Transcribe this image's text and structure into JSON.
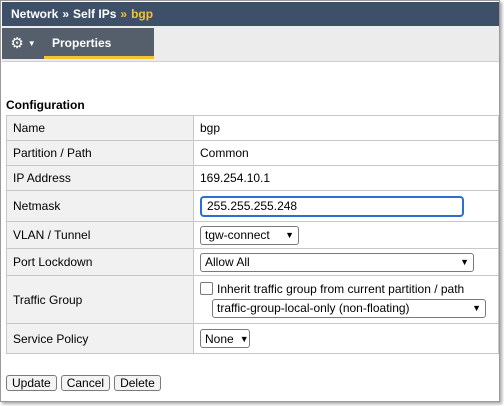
{
  "breadcrumb": {
    "items": [
      "Network",
      "Self IPs"
    ],
    "separator": "»",
    "current": "bgp"
  },
  "tabs": {
    "gear_icon": "gear-icon",
    "active_tab": "Properties"
  },
  "section_title": "Configuration",
  "fields": {
    "name": {
      "label": "Name",
      "value": "bgp"
    },
    "partition": {
      "label": "Partition / Path",
      "value": "Common"
    },
    "ip_address": {
      "label": "IP Address",
      "value": "169.254.10.1"
    },
    "netmask": {
      "label": "Netmask",
      "value": "255.255.255.248"
    },
    "vlan": {
      "label": "VLAN / Tunnel",
      "value": "tgw-connect"
    },
    "port_lockdown": {
      "label": "Port Lockdown",
      "value": "Allow All"
    },
    "traffic_group": {
      "label": "Traffic Group",
      "inherit_label": "Inherit traffic group from current partition / path",
      "inherit_checked": false,
      "value": "traffic-group-local-only (non-floating)"
    },
    "service_policy": {
      "label": "Service Policy",
      "value": "None"
    }
  },
  "buttons": {
    "update": "Update",
    "cancel": "Cancel",
    "delete": "Delete"
  },
  "colors": {
    "header_bg": "#3e5069",
    "accent": "#f5c232",
    "tab_bg": "#555f6c",
    "focus_border": "#2a6fd1"
  }
}
